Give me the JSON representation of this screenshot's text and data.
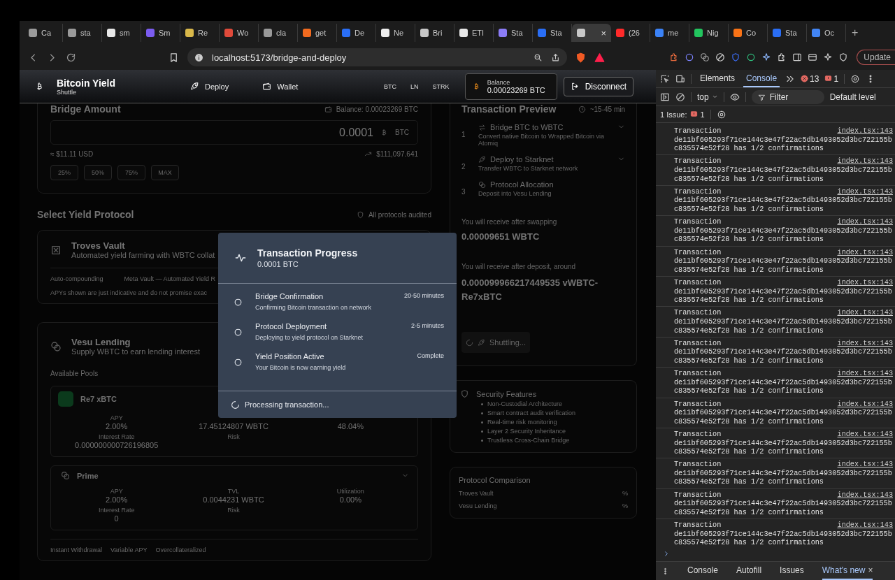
{
  "browser": {
    "tabs": [
      {
        "label": "Ca",
        "selected": false,
        "color": "#9a9a9a"
      },
      {
        "label": "sta",
        "selected": false,
        "color": "#9a9a9a"
      },
      {
        "label": "sm",
        "selected": false,
        "color": "#e8e8e8"
      },
      {
        "label": "Sm",
        "selected": false,
        "color": "#7b5cf0"
      },
      {
        "label": "Re",
        "selected": false,
        "color": "#d9b84a"
      },
      {
        "label": "Wo",
        "selected": false,
        "color": "#e04a3a"
      },
      {
        "label": "cla",
        "selected": false,
        "color": "#9a9a9a"
      },
      {
        "label": "get",
        "selected": false,
        "color": "#f26b1f"
      },
      {
        "label": "De",
        "selected": false,
        "color": "#2a6ef5"
      },
      {
        "label": "Ne",
        "selected": false,
        "color": "#eeeeee"
      },
      {
        "label": "Bri",
        "selected": false,
        "color": "#c8c8c8"
      },
      {
        "label": "ETI",
        "selected": false,
        "color": "#e8e8e8"
      },
      {
        "label": "Sta",
        "selected": false,
        "color": "#8b7cf6"
      },
      {
        "label": "Sta",
        "selected": false,
        "color": "#2a6ef5"
      },
      {
        "selected": true,
        "color": "#c8c8c8",
        "close": "×"
      },
      {
        "label": "(26",
        "selected": false,
        "color": "#ff2a2a"
      },
      {
        "label": "me",
        "selected": false,
        "color": "#3b82f6"
      },
      {
        "label": "Nig",
        "selected": false,
        "color": "#22c55e"
      },
      {
        "label": "Co",
        "selected": false,
        "color": "#f97316"
      },
      {
        "label": "Sta",
        "selected": false,
        "color": "#2a6ef5"
      },
      {
        "label": "Oc",
        "selected": false,
        "color": "#4285f4"
      }
    ],
    "new_tab": "+",
    "address": "localhost:5173/bridge-and-deploy",
    "update_button": "Update"
  },
  "app": {
    "header": {
      "title": "Bitcoin Yield",
      "subtitle": "Shuttle",
      "nav": [
        {
          "label": "Deploy",
          "kind": "rocket"
        },
        {
          "label": "Wallet",
          "kind": "wallet"
        }
      ],
      "networks": [
        "BTC",
        "LN",
        "STRK"
      ],
      "balance_label": "Balance",
      "balance": "0.00023269 BTC",
      "disconnect": "Disconnect"
    },
    "bridge": {
      "title": "Bridge Amount",
      "balance": "Balance: 0.00023269 BTC",
      "amount": "0.0001",
      "unit": "BTC",
      "usd": "≈ $11.11 USD",
      "price": "$111,097.641",
      "presets": [
        "25%",
        "50%",
        "75%",
        "MAX"
      ]
    },
    "protocols": {
      "title": "Select Yield Protocol",
      "audited": "All protocols audited",
      "troves": {
        "title": "Troves Vault",
        "description": "Automated yield farming with WBTC collat",
        "tags": [
          "Auto-compounding",
          "Meta Vault — Automated Yield R"
        ],
        "note": "APYs shown are just indicative and do not promise exac"
      },
      "vesu": {
        "title": "Vesu Lending",
        "description": "Supply WBTC to earn lending interest",
        "pools_label": "Available Pools",
        "pools": [
          {
            "name": "Re7 xBTC",
            "selected": true,
            "stats": [
              {
                "label": "APY",
                "value": "2.00%"
              },
              {
                "value": "17.45124807 WBTC"
              },
              {
                "value": "48.04%"
              },
              {
                "label": "Interest Rate",
                "value": "0.000000000726196805"
              },
              {
                "label": "Risk"
              }
            ]
          },
          {
            "name": "Prime",
            "selected": false,
            "stats": [
              {
                "label": "APY",
                "value": "2.00%"
              },
              {
                "label": "TVL",
                "value": "0.0044231 WBTC"
              },
              {
                "label": "Utilization",
                "value": "0.00%"
              },
              {
                "label": "Interest Rate",
                "value": "0"
              },
              {
                "label": "Risk"
              }
            ]
          }
        ],
        "tags": [
          "Instant Withdrawal",
          "Variable APY",
          "Overcollateralized"
        ]
      }
    },
    "preview": {
      "title": "Transaction Preview",
      "eta": "~15-45 min",
      "steps": [
        {
          "number": "1",
          "kind": "swap",
          "title": "Bridge BTC to WBTC",
          "description": "Convert native Bitcoin to Wrapped Bitcoin via Atomiq",
          "expandable": true
        },
        {
          "number": "2",
          "kind": "rocket",
          "title": "Deploy to Starknet",
          "description": "Transfer WBTC to Starknet network",
          "expandable": true
        },
        {
          "number": "3",
          "kind": "coins",
          "title": "Protocol Allocation",
          "description": "Deposit into Vesu Lending",
          "expandable": false
        }
      ],
      "swap_label": "You will receive after swapping",
      "swap_amount": "0.00009651 WBTC",
      "deposit_label": "You will receive after deposit, around",
      "deposit_amount": "0.000099966217449535 vWBTC-Re7xBTC",
      "button": "Shuttling..."
    },
    "security": {
      "title": "Security Features",
      "items": [
        "Non-Custodial Architecture",
        "Smart contract audit verification",
        "Real-time risk monitoring",
        "Layer 2 Security Inheritance",
        "Trustless Cross-Chain Bridge"
      ]
    },
    "comparison": {
      "title": "Protocol Comparison",
      "rows": [
        {
          "name": "Troves Vault",
          "value": "%"
        },
        {
          "name": "Vesu Lending",
          "value": "%"
        }
      ]
    }
  },
  "modal": {
    "title": "Transaction Progress",
    "amount": "0.0001 BTC",
    "steps": [
      {
        "title": "Bridge Confirmation",
        "description": "Confirming Bitcoin transaction on network",
        "time": "20-50 minutes",
        "done": false
      },
      {
        "title": "Protocol Deployment",
        "description": "Deploying to yield protocol on Starknet",
        "time": "2-5 minutes",
        "done": false
      },
      {
        "title": "Yield Position Active",
        "description": "Your Bitcoin is now earning yield",
        "time": "Complete",
        "done": false
      }
    ],
    "status": "Processing transaction..."
  },
  "devtools": {
    "panels": [
      {
        "label": "Elements",
        "selected": false
      },
      {
        "label": "Console",
        "selected": true
      }
    ],
    "error_count": "13",
    "issue_count": "1",
    "context": "top",
    "filter_placeholder": "Filter",
    "levels": "Default level",
    "issues_label": "1 Issue:",
    "issues_badge": "1",
    "messages": [
      {
        "title": "Transaction",
        "detail": "de11bf605293f71ce144c3e47f22ac5db1493052d3bc722155bc835574e52f28 has 1/2 confirmations",
        "source": "index.tsx:143"
      },
      {
        "title": "Transaction",
        "detail": "de11bf605293f71ce144c3e47f22ac5db1493052d3bc722155bc835574e52f28 has 1/2 confirmations",
        "source": "index.tsx:143"
      },
      {
        "title": "Transaction",
        "detail": "de11bf605293f71ce144c3e47f22ac5db1493052d3bc722155bc835574e52f28 has 1/2 confirmations",
        "source": "index.tsx:143"
      },
      {
        "title": "Transaction",
        "detail": "de11bf605293f71ce144c3e47f22ac5db1493052d3bc722155bc835574e52f28 has 1/2 confirmations",
        "source": "index.tsx:143"
      },
      {
        "title": "Transaction",
        "detail": "de11bf605293f71ce144c3e47f22ac5db1493052d3bc722155bc835574e52f28 has 1/2 confirmations",
        "source": "index.tsx:143"
      },
      {
        "title": "Transaction",
        "detail": "de11bf605293f71ce144c3e47f22ac5db1493052d3bc722155bc835574e52f28 has 1/2 confirmations",
        "source": "index.tsx:143"
      },
      {
        "title": "Transaction",
        "detail": "de11bf605293f71ce144c3e47f22ac5db1493052d3bc722155bc835574e52f28 has 1/2 confirmations",
        "source": "index.tsx:143"
      },
      {
        "title": "Transaction",
        "detail": "de11bf605293f71ce144c3e47f22ac5db1493052d3bc722155bc835574e52f28 has 1/2 confirmations",
        "source": "index.tsx:143"
      },
      {
        "title": "Transaction",
        "detail": "de11bf605293f71ce144c3e47f22ac5db1493052d3bc722155bc835574e52f28 has 1/2 confirmations",
        "source": "index.tsx:143"
      },
      {
        "title": "Transaction",
        "detail": "de11bf605293f71ce144c3e47f22ac5db1493052d3bc722155bc835574e52f28 has 1/2 confirmations",
        "source": "index.tsx:143"
      },
      {
        "title": "Transaction",
        "detail": "de11bf605293f71ce144c3e47f22ac5db1493052d3bc722155bc835574e52f28 has 1/2 confirmations",
        "source": "index.tsx:143"
      },
      {
        "title": "Transaction",
        "detail": "de11bf605293f71ce144c3e47f22ac5db1493052d3bc722155bc835574e52f28 has 1/2 confirmations",
        "source": "index.tsx:143"
      },
      {
        "title": "Transaction",
        "detail": "de11bf605293f71ce144c3e47f22ac5db1493052d3bc722155bc835574e52f28 has 1/2 confirmations",
        "source": "index.tsx:143"
      },
      {
        "title": "Transaction",
        "detail": "de11bf605293f71ce144c3e47f22ac5db1493052d3bc722155bc835574e52f28 has 1/2 confirmations",
        "source": "index.tsx:143"
      }
    ],
    "drawer_tabs": [
      {
        "label": "Console",
        "selected": false
      },
      {
        "label": "Autofill",
        "selected": false
      },
      {
        "label": "Issues",
        "selected": false
      },
      {
        "label": "What's new",
        "selected": true,
        "close": "×"
      }
    ]
  }
}
